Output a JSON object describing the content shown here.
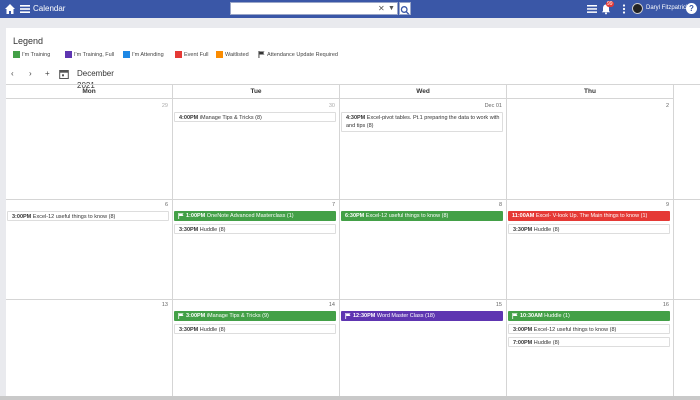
{
  "app": {
    "title": "Calendar"
  },
  "search": {
    "value": "",
    "placeholder": ""
  },
  "user": {
    "name": "Daryl Fitzpatrick",
    "notifications": "99"
  },
  "legend": {
    "title": "Legend",
    "items": [
      {
        "label": "I'm Training",
        "color": "#43a047"
      },
      {
        "label": "I'm Training, Full",
        "color": "#5e35b1"
      },
      {
        "label": "I'm Attending",
        "color": "#1e88e5"
      },
      {
        "label": "Event Full",
        "color": "#e53935"
      },
      {
        "label": "Waitlisted",
        "color": "#fb8c00"
      },
      {
        "label": "Attendance Update Required",
        "icon": "flag-icon"
      }
    ]
  },
  "toolbar": {
    "month": "December 2021"
  },
  "days": [
    "Mon",
    "Tue",
    "Wed",
    "Thu"
  ],
  "weeks": [
    {
      "dates": [
        "29",
        "30",
        "Dec 01",
        "2"
      ],
      "events": [
        [],
        [
          {
            "time": "4:00PM",
            "text": "iManage Tips & Tricks (8)"
          }
        ],
        [
          {
            "time": "4:30PM",
            "text": "Excel-pivot tables. Pt.1 preparing the data to work with and tips (8)"
          }
        ],
        []
      ]
    },
    {
      "dates": [
        "6",
        "7",
        "8",
        "9"
      ],
      "events": [
        [
          {
            "time": "3:00PM",
            "text": "Excel-12 useful things to know (8)"
          }
        ],
        [
          {
            "time": "1:00PM",
            "text": "OneNote Advanced Masterclass (1)"
          },
          {
            "time": "3:30PM",
            "text": "Huddle (8)"
          }
        ],
        [
          {
            "time": "6:30PM",
            "text": "Excel-12 useful things to know (8)"
          }
        ],
        [
          {
            "time": "11:00AM",
            "text": "Excel- V-look Up. The Main things to know (1)"
          },
          {
            "time": "3:30PM",
            "text": "Huddle (8)"
          }
        ]
      ]
    },
    {
      "dates": [
        "13",
        "14",
        "15",
        "16"
      ],
      "events": [
        [],
        [
          {
            "time": "3:00PM",
            "text": "iManage Tips & Tricks (9)"
          },
          {
            "time": "3:30PM",
            "text": "Huddle (8)"
          }
        ],
        [
          {
            "time": "12:30PM",
            "text": "Word Master Class (18)"
          }
        ],
        [
          {
            "time": "10:30AM",
            "text": "Huddle (1)"
          },
          {
            "time": "3:00PM",
            "text": "Excel-12 useful things to know (8)"
          },
          {
            "time": "7:00PM",
            "text": "Huddle (8)"
          }
        ]
      ]
    }
  ]
}
